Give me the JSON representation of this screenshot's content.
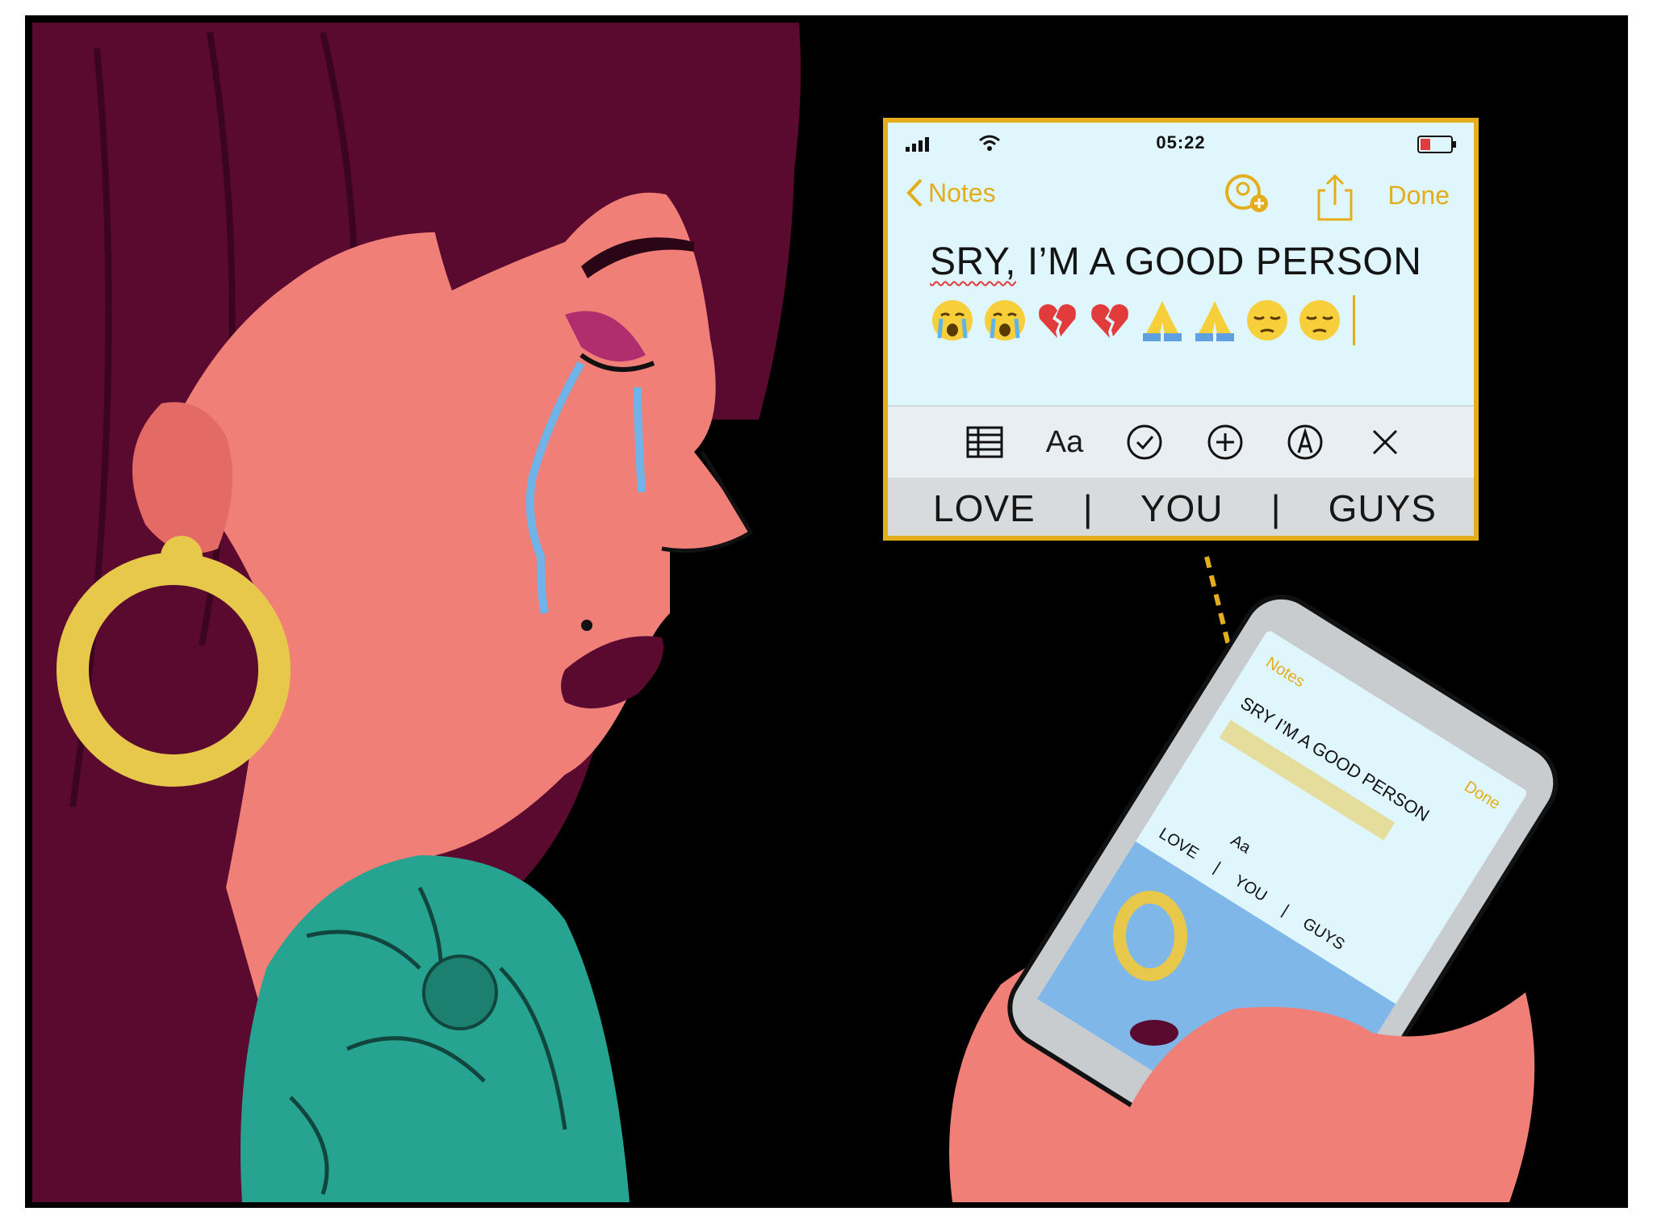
{
  "phone_callout": {
    "status_time": "05:22",
    "nav": {
      "back_label": "Notes",
      "done_label": "Done"
    },
    "note": {
      "misspelled_word": "SRY,",
      "rest_text": " I’M A GOOD PERSON",
      "emojis": [
        "crying-face",
        "crying-face",
        "broken-heart",
        "broken-heart",
        "folded-hands",
        "folded-hands",
        "pensive-face",
        "pensive-face"
      ]
    },
    "toolbar": {
      "format_label": "Aa"
    },
    "suggestions": [
      "LOVE",
      "|",
      "YOU",
      "|",
      "GUYS"
    ]
  },
  "small_phone": {
    "back_label": "Notes",
    "done_label": "Done",
    "note_text": "SRY I’M A GOOD PERSON",
    "format_label": "Aa",
    "suggestions": [
      "LOVE",
      "|",
      "YOU",
      "|",
      "GUYS"
    ]
  },
  "colors": {
    "background": "#000000",
    "hair": "#5a0a2f",
    "skin": "#f07f78",
    "gold": "#e3ad1c",
    "screen": "#dff6fd",
    "tattoo": "#27a391"
  }
}
